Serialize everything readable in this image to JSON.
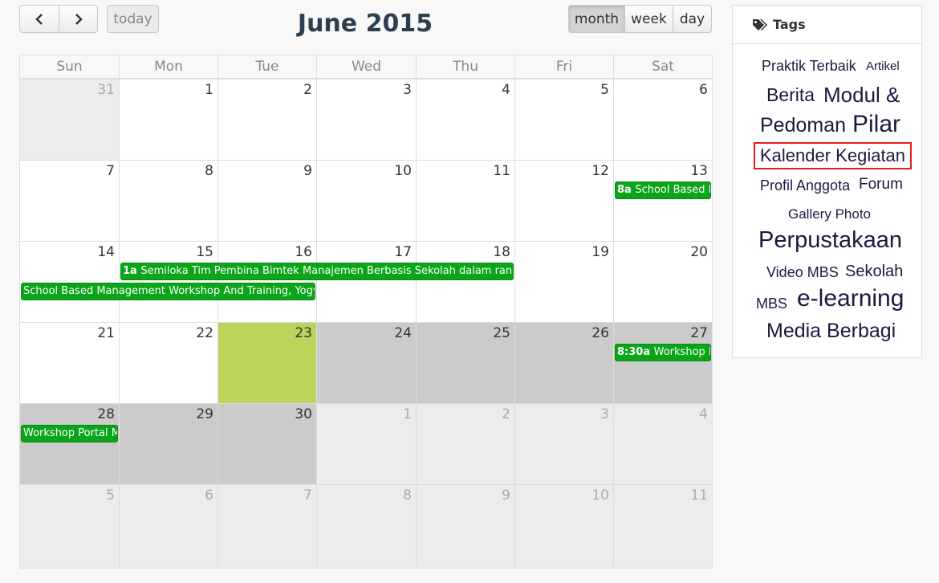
{
  "toolbar": {
    "prev_icon": "chevron-left-icon",
    "next_icon": "chevron-right-icon",
    "today_label": "today",
    "title": "June 2015",
    "views": [
      "month",
      "week",
      "day"
    ],
    "active_view": "month"
  },
  "calendar": {
    "weekdays": [
      "Sun",
      "Mon",
      "Tue",
      "Wed",
      "Thu",
      "Fri",
      "Sat"
    ],
    "weeks": [
      [
        {
          "n": "31",
          "s": "other"
        },
        {
          "n": "1",
          "s": "cur"
        },
        {
          "n": "2",
          "s": "cur"
        },
        {
          "n": "3",
          "s": "cur"
        },
        {
          "n": "4",
          "s": "cur"
        },
        {
          "n": "5",
          "s": "cur"
        },
        {
          "n": "6",
          "s": "cur"
        }
      ],
      [
        {
          "n": "7",
          "s": "cur"
        },
        {
          "n": "8",
          "s": "cur"
        },
        {
          "n": "9",
          "s": "cur"
        },
        {
          "n": "10",
          "s": "cur"
        },
        {
          "n": "11",
          "s": "cur"
        },
        {
          "n": "12",
          "s": "cur"
        },
        {
          "n": "13",
          "s": "cur"
        }
      ],
      [
        {
          "n": "14",
          "s": "cur"
        },
        {
          "n": "15",
          "s": "cur"
        },
        {
          "n": "16",
          "s": "cur"
        },
        {
          "n": "17",
          "s": "cur"
        },
        {
          "n": "18",
          "s": "cur"
        },
        {
          "n": "19",
          "s": "cur"
        },
        {
          "n": "20",
          "s": "cur"
        }
      ],
      [
        {
          "n": "21",
          "s": "cur"
        },
        {
          "n": "22",
          "s": "cur"
        },
        {
          "n": "23",
          "s": "today"
        },
        {
          "n": "24",
          "s": "past"
        },
        {
          "n": "25",
          "s": "past"
        },
        {
          "n": "26",
          "s": "past"
        },
        {
          "n": "27",
          "s": "past"
        }
      ],
      [
        {
          "n": "28",
          "s": "past"
        },
        {
          "n": "29",
          "s": "past"
        },
        {
          "n": "30",
          "s": "past"
        },
        {
          "n": "1",
          "s": "other"
        },
        {
          "n": "2",
          "s": "other"
        },
        {
          "n": "3",
          "s": "other"
        },
        {
          "n": "4",
          "s": "other"
        }
      ],
      [
        {
          "n": "5",
          "s": "other"
        },
        {
          "n": "6",
          "s": "other"
        },
        {
          "n": "7",
          "s": "other"
        },
        {
          "n": "8",
          "s": "other"
        },
        {
          "n": "9",
          "s": "other"
        },
        {
          "n": "10",
          "s": "other"
        },
        {
          "n": "11",
          "s": "other"
        }
      ]
    ],
    "events": [
      {
        "week": 1,
        "start": 6,
        "span": 1,
        "slot": 0,
        "time": "8a",
        "title": "School Based Management Workshop"
      },
      {
        "week": 2,
        "start": 1,
        "span": 4,
        "slot": 0,
        "time": "1a",
        "title": "Semiloka Tim Pembina Bimtek Manajemen Berbasis Sekolah dalam rangka"
      },
      {
        "week": 2,
        "start": 0,
        "span": 3,
        "slot": 1,
        "time": "",
        "title": "School Based Management Workshop And Training, Yogyakarta"
      },
      {
        "week": 3,
        "start": 6,
        "span": 1,
        "slot": 0,
        "time": "8:30a",
        "title": "Workshop Portal MBS"
      },
      {
        "week": 4,
        "start": 0,
        "span": 1,
        "slot": 0,
        "time": "",
        "title": "Workshop Portal MBS"
      }
    ],
    "colors": {
      "event": "#0aa518",
      "today": "#bbd45a",
      "past": "#cbcbcb",
      "other": "#ececec"
    }
  },
  "tags": {
    "header": "Tags",
    "header_icon": "tags-icon",
    "items": [
      {
        "label": "Praktik Terbaik",
        "size": 18
      },
      {
        "label": "Artikel",
        "size": 15
      },
      {
        "label": "Berita",
        "size": 23
      },
      {
        "label": "Modul &",
        "size": 26
      },
      {
        "label": "Pedoman",
        "size": 25
      },
      {
        "label": "Pilar",
        "size": 30
      },
      {
        "label": "Kalender Kegiatan",
        "size": 22,
        "highlight": true
      },
      {
        "label": "Profil Anggota",
        "size": 18
      },
      {
        "label": "Forum",
        "size": 19
      },
      {
        "label": "Gallery Photo",
        "size": 17
      },
      {
        "label": "Perpustakaan",
        "size": 29
      },
      {
        "label": "Video MBS",
        "size": 18
      },
      {
        "label": "Sekolah",
        "size": 20
      },
      {
        "label": "MBS",
        "size": 18
      },
      {
        "label": "e-learning",
        "size": 30
      },
      {
        "label": "Media Berbagi",
        "size": 25
      }
    ]
  }
}
